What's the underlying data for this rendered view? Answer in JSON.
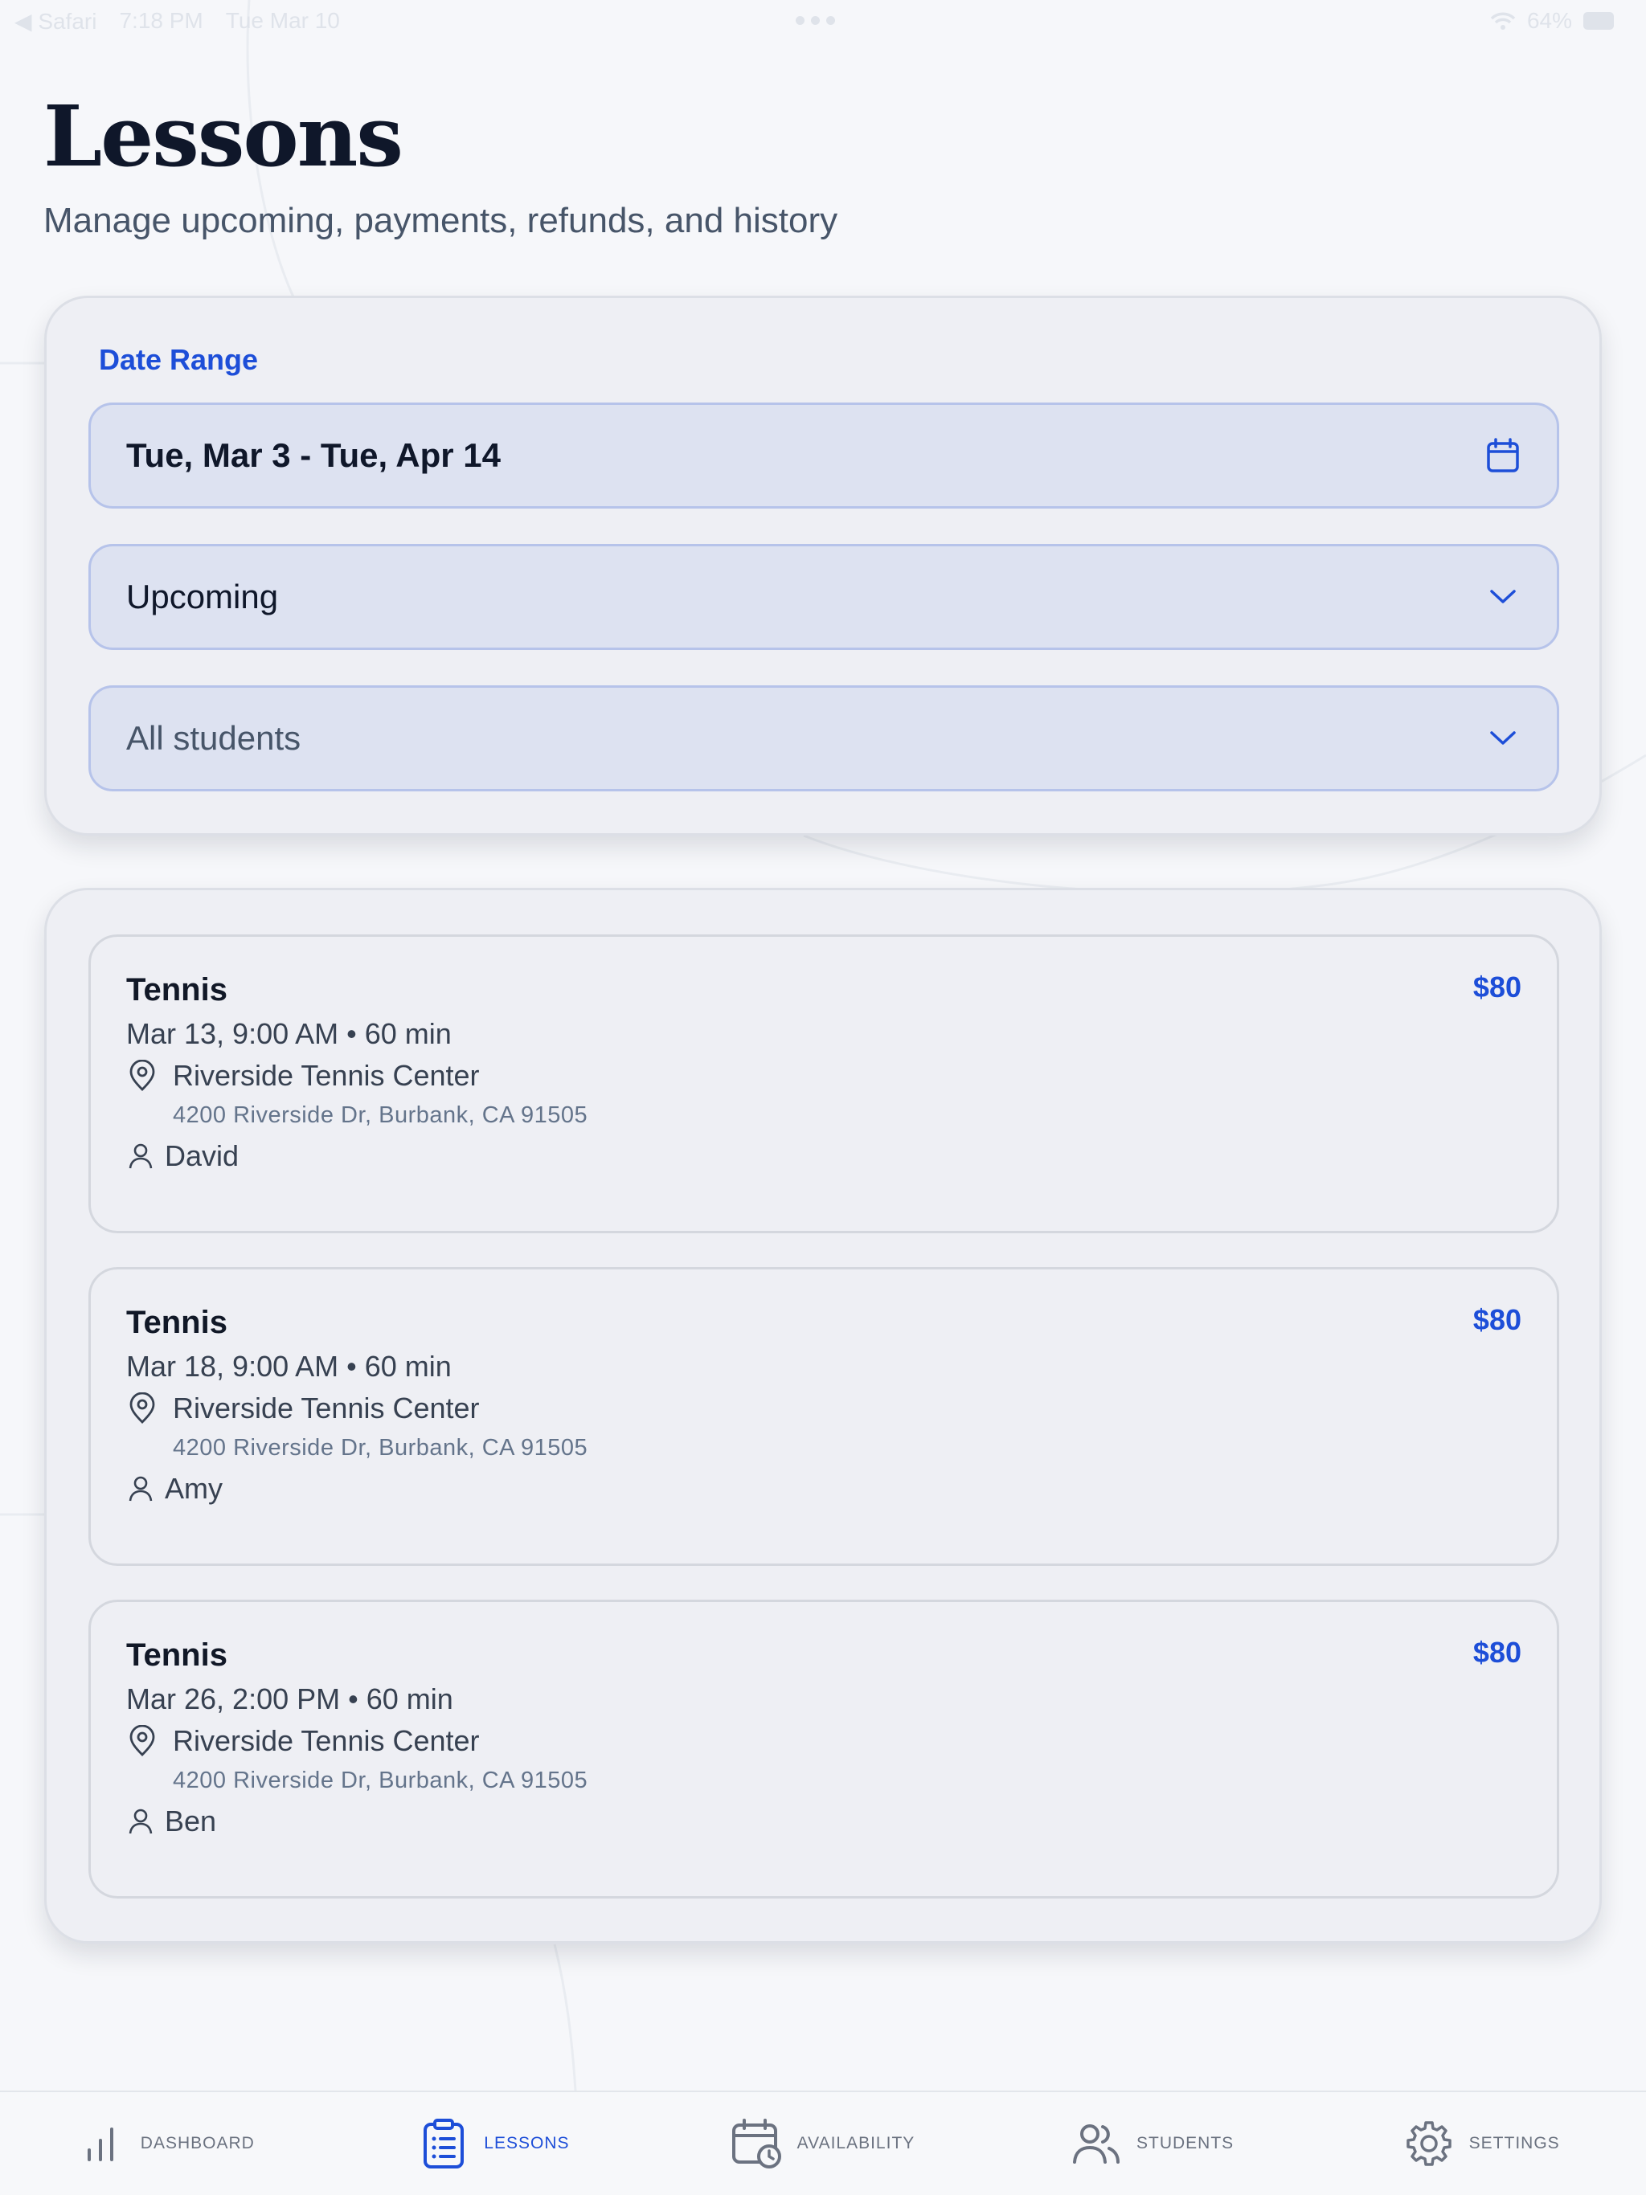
{
  "status_bar": {
    "back_app": "◀ Safari",
    "time": "7:18 PM",
    "date": "Tue Mar 10",
    "battery": "64%"
  },
  "header": {
    "title": "Lessons",
    "subtitle": "Manage upcoming, payments, refunds, and history"
  },
  "filters": {
    "date_range_label": "Date Range",
    "date_range_value": "Tue, Mar 3 - Tue, Apr 14",
    "status_value": "Upcoming",
    "student_value": "All students"
  },
  "lessons": [
    {
      "title": "Tennis",
      "price": "$80",
      "when": "Mar 13, 9:00 AM • 60 min",
      "location": "Riverside Tennis Center",
      "address": "4200 Riverside Dr, Burbank, CA 91505",
      "student": "David"
    },
    {
      "title": "Tennis",
      "price": "$80",
      "when": "Mar 18, 9:00 AM • 60 min",
      "location": "Riverside Tennis Center",
      "address": "4200 Riverside Dr, Burbank, CA 91505",
      "student": "Amy"
    },
    {
      "title": "Tennis",
      "price": "$80",
      "when": "Mar 26, 2:00 PM • 60 min",
      "location": "Riverside Tennis Center",
      "address": "4200 Riverside Dr, Burbank, CA 91505",
      "student": "Ben"
    }
  ],
  "tabs": [
    {
      "label": "DASHBOARD",
      "icon": "bar-chart-icon"
    },
    {
      "label": "LESSONS",
      "icon": "clipboard-list-icon"
    },
    {
      "label": "AVAILABILITY",
      "icon": "calendar-clock-icon"
    },
    {
      "label": "STUDENTS",
      "icon": "users-icon"
    },
    {
      "label": "SETTINGS",
      "icon": "gear-icon"
    }
  ],
  "colors": {
    "accent": "#1d4ed8",
    "background": "#f6f7fa",
    "card": "#eeeff4",
    "field": "#dde2f1"
  }
}
